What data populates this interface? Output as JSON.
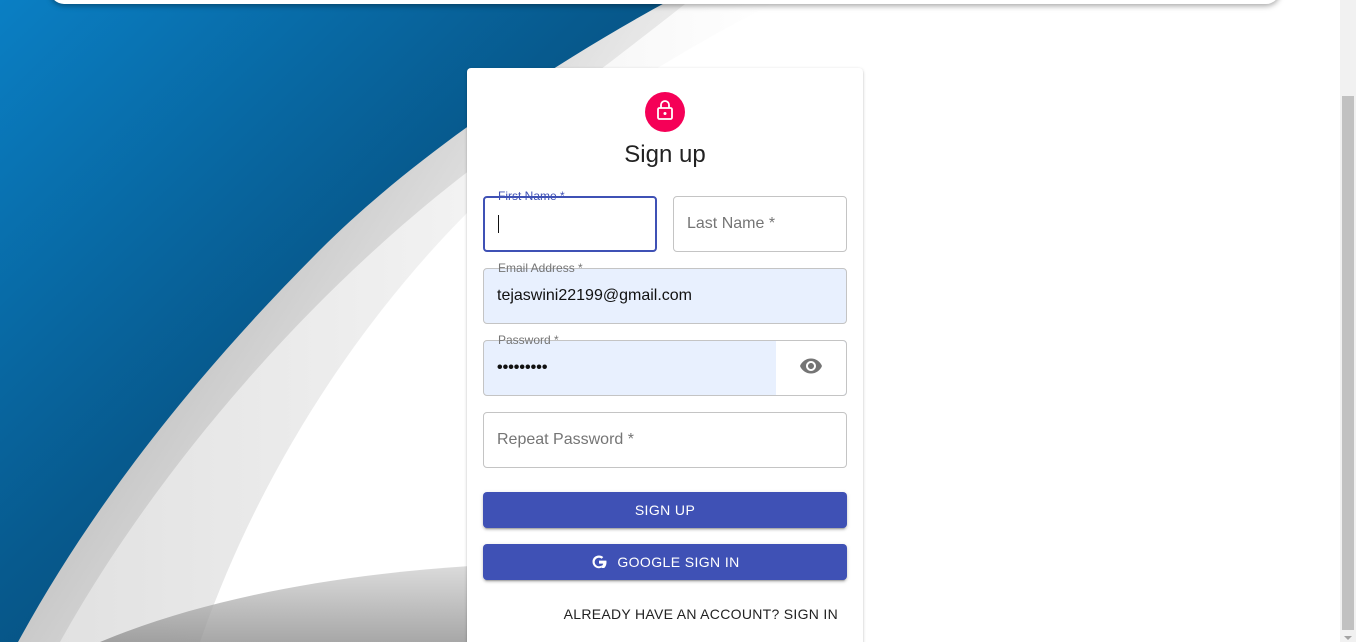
{
  "form": {
    "title": "Sign up",
    "first_name": {
      "label": "First Name *",
      "value": ""
    },
    "last_name": {
      "label": "Last Name *",
      "value": ""
    },
    "email": {
      "label": "Email Address *",
      "value": "tejaswini22199@gmail.com"
    },
    "password": {
      "label": "Password *",
      "value": "•••••••••"
    },
    "repeat_password": {
      "label": "Repeat Password *",
      "value": ""
    },
    "signup_button": "SIGN UP",
    "google_button": "GOOGLE SIGN IN",
    "signin_link": "ALREADY HAVE AN ACCOUNT? SIGN IN"
  },
  "icons": {
    "avatar": "lock-icon",
    "password_toggle": "eye-icon",
    "google": "google-icon"
  },
  "colors": {
    "primary": "#3f51b5",
    "avatar": "#f50057",
    "autofill": "#e8f0fe",
    "background_blue": "#0a6fa8"
  }
}
